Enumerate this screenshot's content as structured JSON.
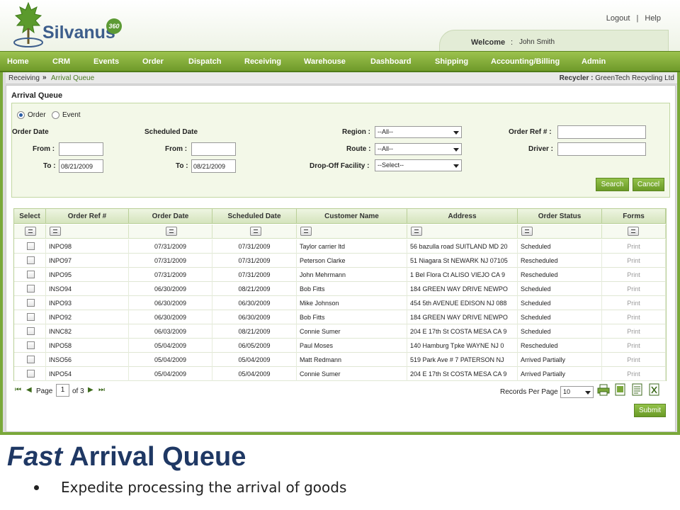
{
  "header": {
    "logo_text": "Silvanus",
    "logo_badge": "360",
    "logout": "Logout",
    "separator": "|",
    "help": "Help",
    "welcome_label": "Welcome",
    "welcome_colon": ":",
    "user_name": "John Smith"
  },
  "nav": {
    "items": [
      "Home",
      "CRM",
      "Events",
      "Order",
      "Dispatch",
      "Receiving",
      "Warehouse",
      "Dashboard",
      "Shipping",
      "Accounting/Billing",
      "Admin"
    ]
  },
  "breadcrumb": {
    "parent": "Receiving",
    "current": "Arrival Queue",
    "recycler_label": "Recycler :",
    "recycler_value": "GreenTech Recycling Ltd"
  },
  "panel": {
    "title": "Arrival Queue"
  },
  "filters": {
    "radio_order": "Order",
    "radio_event": "Event",
    "selected": "Order",
    "order_date_label": "Order Date",
    "scheduled_date_label": "Scheduled Date",
    "from_label": "From :",
    "to_label": "To :",
    "order_from": "",
    "order_to": "08/21/2009",
    "sched_from": "",
    "sched_to": "08/21/2009",
    "region_label": "Region :",
    "region_value": "--All--",
    "route_label": "Route :",
    "route_value": "--All--",
    "facility_label": "Drop-Off Facility :",
    "facility_value": "--Select--",
    "order_ref_label": "Order Ref # :",
    "order_ref_value": "",
    "driver_label": "Driver :",
    "driver_value": "",
    "search_button": "Search",
    "cancel_button": "Cancel"
  },
  "table": {
    "columns": [
      "Select",
      "Order Ref #",
      "Order Date",
      "Scheduled Date",
      "Customer Name",
      "Address",
      "Order Status",
      "Forms"
    ],
    "rows": [
      {
        "ref": "INPO98",
        "order_date": "07/31/2009",
        "sched_date": "07/31/2009",
        "customer": "Taylor carrier ltd",
        "address": "56 bazulla road SUITLAND MD 20",
        "status": "Scheduled",
        "form": "Print"
      },
      {
        "ref": "INPO97",
        "order_date": "07/31/2009",
        "sched_date": "07/31/2009",
        "customer": "Peterson Clarke",
        "address": "51 Niagara St NEWARK NJ 07105",
        "status": "Rescheduled",
        "form": "Print"
      },
      {
        "ref": "INPO95",
        "order_date": "07/31/2009",
        "sched_date": "07/31/2009",
        "customer": "John Mehrmann",
        "address": "1 Bel Flora Ct ALISO VIEJO CA 9",
        "status": "Rescheduled",
        "form": "Print"
      },
      {
        "ref": "INSO94",
        "order_date": "06/30/2009",
        "sched_date": "08/21/2009",
        "customer": "Bob Fitts",
        "address": "184 GREEN WAY DRIVE NEWPO",
        "status": "Scheduled",
        "form": "Print"
      },
      {
        "ref": "INPO93",
        "order_date": "06/30/2009",
        "sched_date": "06/30/2009",
        "customer": "Mike Johnson",
        "address": "454 5th AVENUE EDISON NJ 088",
        "status": "Scheduled",
        "form": "Print"
      },
      {
        "ref": "INPO92",
        "order_date": "06/30/2009",
        "sched_date": "06/30/2009",
        "customer": "Bob Fitts",
        "address": "184 GREEN WAY DRIVE NEWPO",
        "status": "Scheduled",
        "form": "Print"
      },
      {
        "ref": "INNC82",
        "order_date": "06/03/2009",
        "sched_date": "08/21/2009",
        "customer": "Connie Sumer",
        "address": "204 E 17th St COSTA MESA CA 9",
        "status": "Scheduled",
        "form": "Print"
      },
      {
        "ref": "INPO58",
        "order_date": "05/04/2009",
        "sched_date": "06/05/2009",
        "customer": "Paul Moses",
        "address": "140 Hamburg Tpke WAYNE NJ 0",
        "status": "Rescheduled",
        "form": "Print"
      },
      {
        "ref": "INSO56",
        "order_date": "05/04/2009",
        "sched_date": "05/04/2009",
        "customer": "Matt Redmann",
        "address": "519 Park Ave # 7 PATERSON NJ",
        "status": "Arrived Partially",
        "form": "Print"
      },
      {
        "ref": "INPO54",
        "order_date": "05/04/2009",
        "sched_date": "05/04/2009",
        "customer": "Connie Sumer",
        "address": "204 E 17th St COSTA MESA CA 9",
        "status": "Arrived Partially",
        "form": "Print"
      }
    ]
  },
  "pager": {
    "page_label": "Page",
    "page_value": "1",
    "of_label": "of 3",
    "records_label": "Records Per Page",
    "records_value": "10",
    "submit_button": "Submit"
  },
  "slide": {
    "title_italic": "Fast",
    "title_rest": "Arrival Queue",
    "bullet": "Expedite processing the arrival of goods"
  },
  "colors": {
    "nav_green": "#7aa83a",
    "title_blue": "#1f3864",
    "logo_blue": "#3d5e8c"
  }
}
